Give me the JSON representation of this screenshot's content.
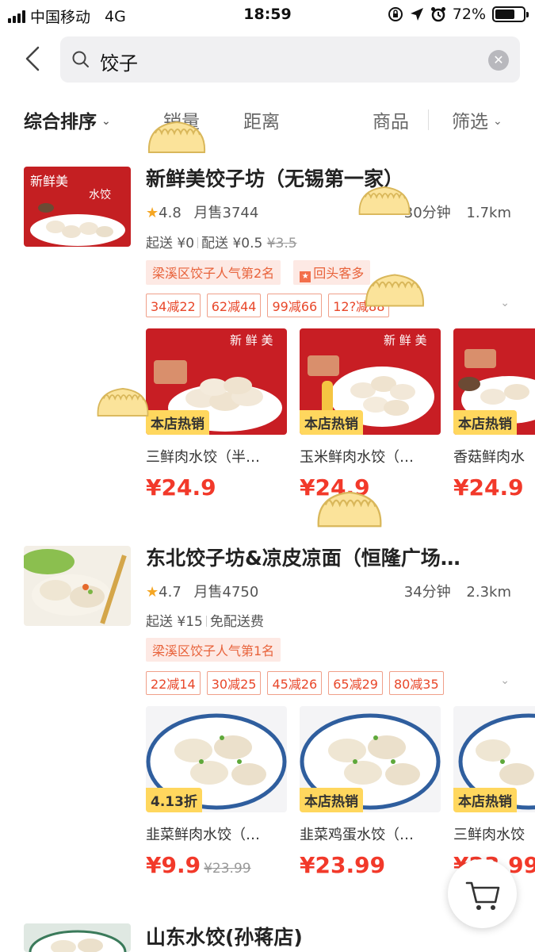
{
  "status_bar": {
    "carrier": "中国移动",
    "network": "4G",
    "time": "18:59",
    "battery": "72%",
    "battery_level": 0.72
  },
  "search": {
    "query": "饺子"
  },
  "filters": {
    "sort": "综合排序",
    "sales": "销量",
    "distance": "距离",
    "goods": "商品",
    "filter": "筛选"
  },
  "shops": [
    {
      "name": "新鲜美饺子坊（无锡第一家）",
      "rating": "4.8",
      "monthly_sales": "月售3744",
      "eta": "30分钟",
      "distance": "1.7km",
      "min_order": "起送 ¥0",
      "delivery": "配送 ¥0.5",
      "delivery_original": "¥3.5",
      "rank_tag": "梁溪区饺子人气第2名",
      "repeat_tag": "回头客多",
      "promos": [
        "34减22",
        "62减44",
        "99减66",
        "12?减88"
      ],
      "thumb_text": "新鲜美 水饺",
      "dishes": [
        {
          "badge": "本店热销",
          "name": "三鲜肉水饺（半…",
          "price": "¥24.9",
          "brand": "新 鲜 美"
        },
        {
          "badge": "本店热销",
          "name": "玉米鲜肉水饺（…",
          "price": "¥24.9",
          "brand": "新 鲜 美"
        },
        {
          "badge": "本店热销",
          "name": "香菇鲜肉水",
          "price": "¥24.9",
          "brand": ""
        }
      ]
    },
    {
      "name": "东北饺子坊&凉皮凉面（恒隆广场…",
      "rating": "4.7",
      "monthly_sales": "月售4750",
      "eta": "34分钟",
      "distance": "2.3km",
      "min_order": "起送 ¥15",
      "delivery": "免配送费",
      "rank_tag": "梁溪区饺子人气第1名",
      "promos": [
        "22减14",
        "30减25",
        "45减26",
        "65减29",
        "80减35"
      ],
      "dishes": [
        {
          "badge": "4.13折",
          "name": "韭菜鲜肉水饺（…",
          "price": "¥9.9",
          "original": "¥23.99"
        },
        {
          "badge": "本店热销",
          "name": "韭菜鸡蛋水饺（…",
          "price": "¥23.99"
        },
        {
          "badge": "本店热销",
          "name": "三鲜肉水饺",
          "price": "¥23.99"
        }
      ]
    },
    {
      "name": "山东水饺(孙蒋店)"
    }
  ]
}
